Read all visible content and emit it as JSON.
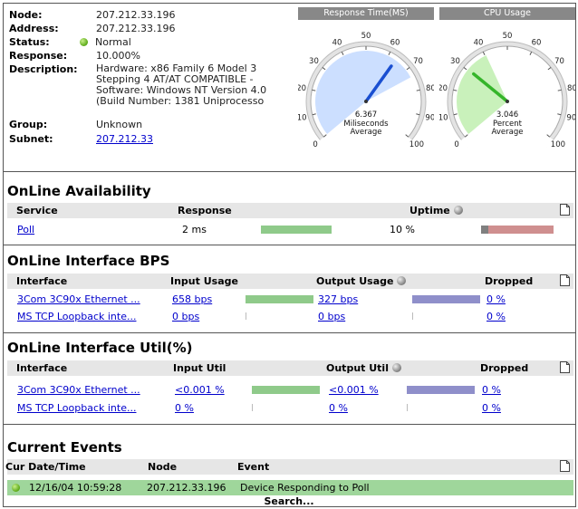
{
  "node": {
    "labels": {
      "node": "Node:",
      "address": "Address:",
      "status": "Status:",
      "response": "Response:",
      "description": "Description:",
      "group": "Group:",
      "subnet": "Subnet:"
    },
    "node_value": "207.212.33.196",
    "address": "207.212.33.196",
    "status": "Normal",
    "status_color": "#5aa917",
    "response": "10.000%",
    "description_lines": [
      "Hardware: x86 Family 6 Model 3",
      "Stepping 4 AT/AT COMPATIBLE -",
      "Software: Windows NT Version 4.0",
      "(Build Number: 1381 Uniprocesso"
    ],
    "group": "Unknown",
    "subnet": "207.212.33"
  },
  "gauges": [
    {
      "title": "Response Time(MS)",
      "value": 6.367,
      "value_text": "6.367",
      "unit_line1": "Miliseconds",
      "unit_line2": "Average",
      "fill_color": "#c6dcff",
      "needle_color": "#1a4fd1",
      "scale": [
        0,
        10,
        20,
        30,
        40,
        50,
        60,
        70,
        80,
        90,
        100
      ]
    },
    {
      "title": "CPU Usage",
      "value": 3.046,
      "value_text": "3.046",
      "unit_line1": "Percent",
      "unit_line2": "Average",
      "fill_color": "#c3f0b4",
      "needle_color": "#35b52a",
      "scale": [
        0,
        10,
        20,
        30,
        40,
        50,
        60,
        70,
        80,
        90,
        100
      ]
    }
  ],
  "availability": {
    "title": "OnLine Availability",
    "headers": {
      "service": "Service",
      "response": "Response",
      "uptime": "Uptime"
    },
    "rows": [
      {
        "service": "Poll",
        "response": "2 ms",
        "uptime": "10 %",
        "response_fraction": 0.55,
        "uptime_fraction": 0.1
      }
    ],
    "bar_colors": {
      "response": "#8fca8a",
      "uptime_good": "#808080",
      "uptime_bad": "#cf8f8f"
    }
  },
  "bps": {
    "title": "OnLine Interface BPS",
    "headers": {
      "interface": "Interface",
      "input": "Input Usage",
      "output": "Output Usage",
      "dropped": "Dropped"
    },
    "rows": [
      {
        "interface": "3Com 3C90x Ethernet ...",
        "input": "658 bps",
        "output": "327 bps",
        "dropped": "0 %",
        "input_fraction": 0.75,
        "output_fraction": 0.75
      },
      {
        "interface": "MS TCP Loopback inte...",
        "input": "0 bps",
        "output": "0 bps",
        "dropped": "0 %",
        "input_fraction": 0.0,
        "output_fraction": 0.0
      }
    ],
    "bar_colors": {
      "input": "#8fca8a",
      "output": "#8f8fca"
    }
  },
  "util": {
    "title": "OnLine Interface Util(%)",
    "headers": {
      "interface": "Interface",
      "input": "Input Util",
      "output": "Output Util",
      "dropped": "Dropped"
    },
    "rows": [
      {
        "interface": "3Com 3C90x Ethernet ...",
        "input": "<0.001 %",
        "output": "<0.001 %",
        "dropped": "0 %",
        "input_fraction": 0.75,
        "output_fraction": 0.75
      },
      {
        "interface": "MS TCP Loopback inte...",
        "input": "0 %",
        "output": "0 %",
        "dropped": "0 %",
        "input_fraction": 0.0,
        "output_fraction": 0.0
      }
    ],
    "bar_colors": {
      "input": "#8fca8a",
      "output": "#8f8fca"
    }
  },
  "events": {
    "title": "Current Events",
    "headers": {
      "datetime": "Cur Date/Time",
      "node": "Node",
      "event": "Event"
    },
    "rows": [
      {
        "datetime": "12/16/04 10:59:28",
        "node": "207.212.33.196",
        "event": "Device Responding to Poll",
        "row_color": "#9fd69b"
      }
    ],
    "search": "Search..."
  }
}
